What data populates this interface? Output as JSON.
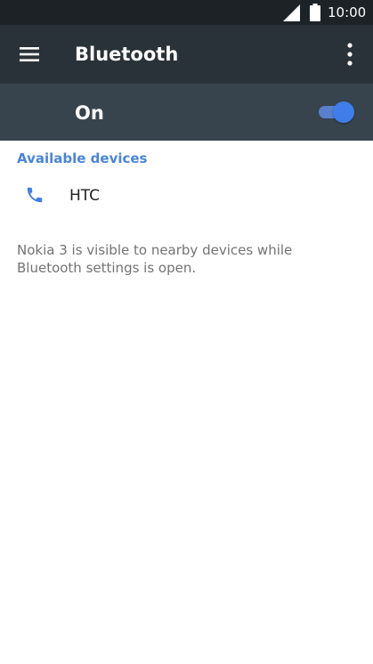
{
  "status_bar": {
    "time": "10:00",
    "icons": [
      "signal-icon",
      "battery-icon"
    ]
  },
  "toolbar": {
    "title": "Bluetooth",
    "menu_icon": "menu-icon",
    "overflow_icon": "overflow-menu-icon"
  },
  "master_switch": {
    "label": "On",
    "state": "on",
    "accent_color": "#3f7ee8"
  },
  "available_devices": {
    "header": "Available devices",
    "items": [
      {
        "name": "HTC",
        "icon": "phone-icon"
      }
    ]
  },
  "footer": {
    "text": "Nokia 3 is visible to nearby devices while Bluetooth settings is open."
  },
  "colors": {
    "status_bar": "#1d2227",
    "toolbar": "#2a3239",
    "switch_bar": "#37444d",
    "section_header": "#4a84d9"
  }
}
